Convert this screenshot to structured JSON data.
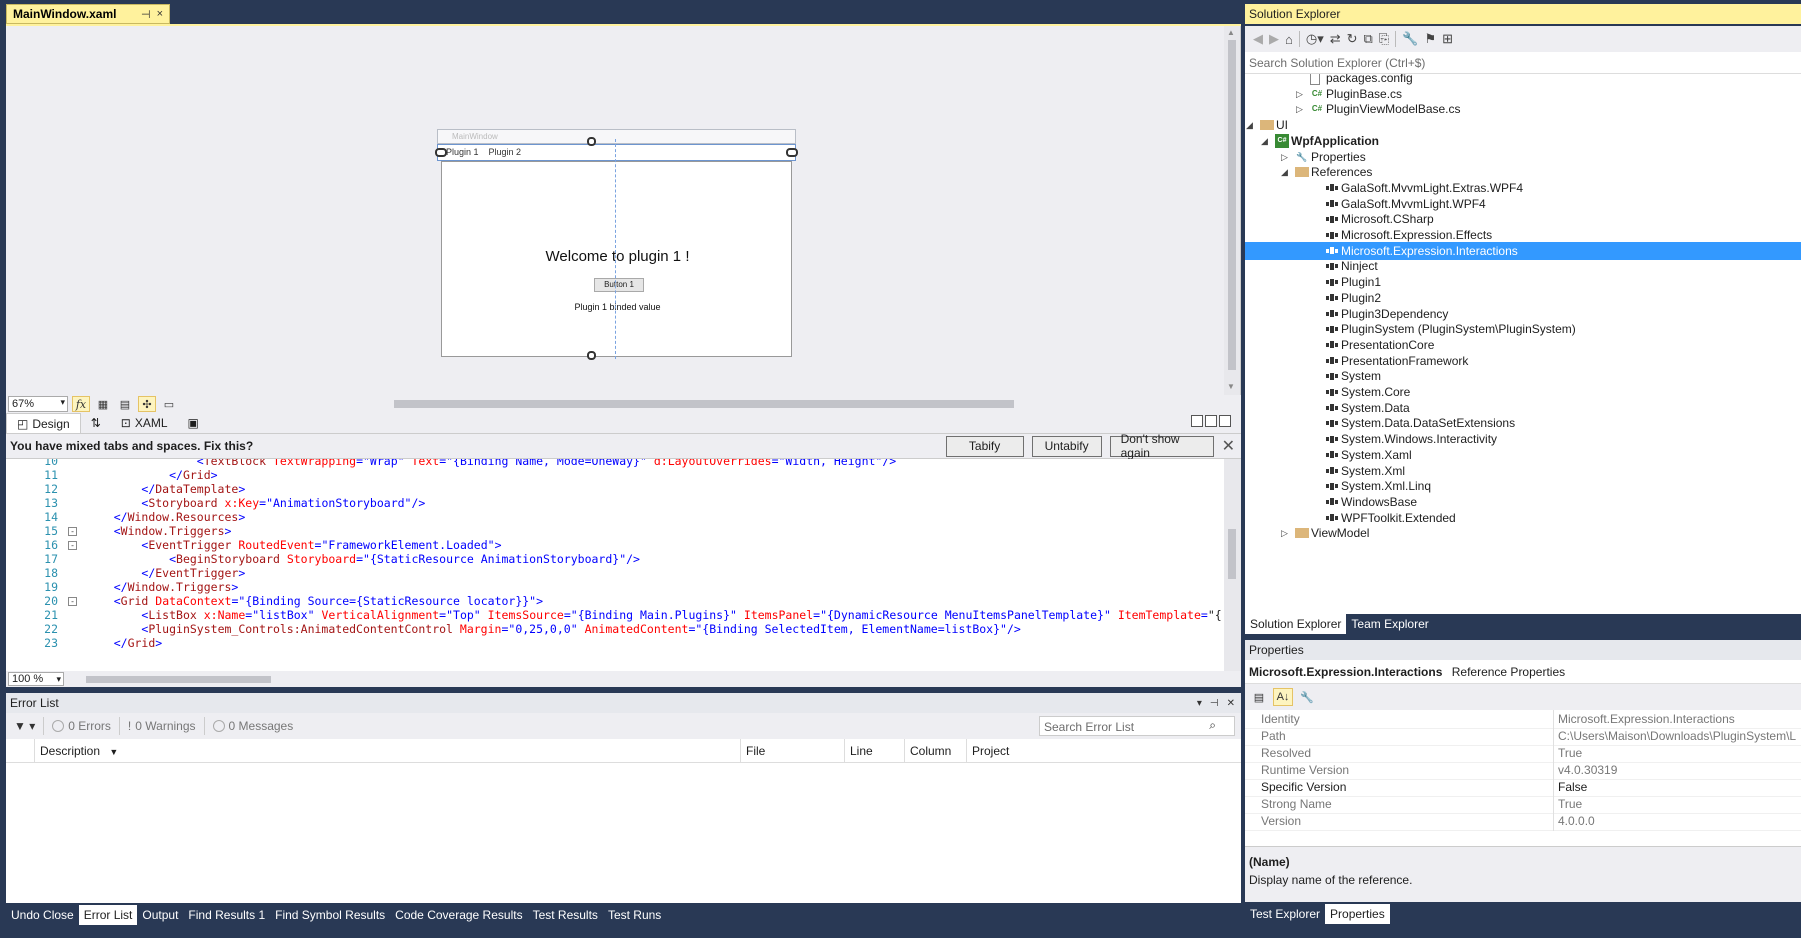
{
  "document_tab": {
    "title": "MainWindow.xaml",
    "pin": "⊣",
    "close": "×"
  },
  "designer": {
    "window_title": "MainWindow",
    "tabs": [
      "Plugin 1",
      "Plugin 2"
    ],
    "welcome": "Welcome to plugin 1 !",
    "button_label": "Button 1",
    "binded_text": "Plugin 1 binded value",
    "zoom": "67%",
    "fx": "fx"
  },
  "view_tabs": {
    "design": "Design",
    "swap": "⇅",
    "xaml": "XAML"
  },
  "infobar": {
    "message": "You have mixed tabs and spaces. Fix this?",
    "tabify": "Tabify",
    "untabify": "Untabify",
    "dont_show": "Don't show again",
    "close": "✕"
  },
  "code_lines": [
    {
      "n": "10",
      "fold": "",
      "text": "                <TextBlock TextWrapping=\"Wrap\" Text=\"{Binding Name, Mode=OneWay}\" d:LayoutOverrides=\"Width, Height\"/>"
    },
    {
      "n": "11",
      "fold": "",
      "text": "            </Grid>"
    },
    {
      "n": "12",
      "fold": "",
      "text": "        </DataTemplate>"
    },
    {
      "n": "13",
      "fold": "",
      "text": "        <Storyboard x:Key=\"AnimationStoryboard\"/>"
    },
    {
      "n": "14",
      "fold": "",
      "text": "    </Window.Resources>"
    },
    {
      "n": "15",
      "fold": "-",
      "text": "    <Window.Triggers>"
    },
    {
      "n": "16",
      "fold": "-",
      "text": "        <EventTrigger RoutedEvent=\"FrameworkElement.Loaded\">"
    },
    {
      "n": "17",
      "fold": "",
      "text": "            <BeginStoryboard Storyboard=\"{StaticResource AnimationStoryboard}\"/>"
    },
    {
      "n": "18",
      "fold": "",
      "text": "        </EventTrigger>"
    },
    {
      "n": "19",
      "fold": "",
      "text": "    </Window.Triggers>"
    },
    {
      "n": "20",
      "fold": "-",
      "text": "    <Grid DataContext=\"{Binding Source={StaticResource locator}}\">"
    },
    {
      "n": "21",
      "fold": "",
      "text": "        <ListBox x:Name=\"listBox\" VerticalAlignment=\"Top\" ItemsSource=\"{Binding Main.Plugins}\" ItemsPanel=\"{DynamicResource MenuItemsPanelTemplate}\" ItemTemplate=\"{"
    },
    {
      "n": "22",
      "fold": "",
      "text": "        <PluginSystem_Controls:AnimatedContentControl Margin=\"0,25,0,0\" AnimatedContent=\"{Binding SelectedItem, ElementName=listBox}\"/>"
    },
    {
      "n": "23",
      "fold": "",
      "text": "    </Grid>"
    }
  ],
  "editor_zoom": "100 %",
  "error_list": {
    "title": "Error List",
    "errors": "0 Errors",
    "warnings": "0 Warnings",
    "messages": "0 Messages",
    "search_placeholder": "Search Error List",
    "columns": [
      "Description",
      "File",
      "Line",
      "Column",
      "Project"
    ]
  },
  "bottom_tabs": [
    "Undo Close",
    "Error List",
    "Output",
    "Find Results 1",
    "Find Symbol Results",
    "Code Coverage Results",
    "Test Results",
    "Test Runs"
  ],
  "solution_explorer": {
    "title": "Solution Explorer",
    "search_placeholder": "Search Solution Explorer (Ctrl+$)",
    "items": [
      {
        "label": "packages.config",
        "type": "config",
        "bold": false
      },
      {
        "label": "PluginBase.cs",
        "type": "cs",
        "bold": false
      },
      {
        "label": "PluginViewModelBase.cs",
        "type": "cs",
        "bold": false
      },
      {
        "label": "UI",
        "type": "folder",
        "bold": false
      },
      {
        "label": "WpfApplication",
        "type": "project",
        "bold": true
      },
      {
        "label": "Properties",
        "type": "wrench",
        "bold": false
      },
      {
        "label": "References",
        "type": "refs",
        "bold": false
      },
      {
        "label": "GalaSoft.MvvmLight.Extras.WPF4",
        "type": "ref",
        "bold": false
      },
      {
        "label": "GalaSoft.MvvmLight.WPF4",
        "type": "ref",
        "bold": false
      },
      {
        "label": "Microsoft.CSharp",
        "type": "ref",
        "bold": false
      },
      {
        "label": "Microsoft.Expression.Effects",
        "type": "ref",
        "bold": false
      },
      {
        "label": "Microsoft.Expression.Interactions",
        "type": "ref",
        "bold": false
      },
      {
        "label": "Ninject",
        "type": "ref",
        "bold": false
      },
      {
        "label": "Plugin1",
        "type": "ref",
        "bold": false
      },
      {
        "label": "Plugin2",
        "type": "ref",
        "bold": false
      },
      {
        "label": "Plugin3Dependency",
        "type": "ref",
        "bold": false
      },
      {
        "label": "PluginSystem (PluginSystem\\PluginSystem)",
        "type": "ref",
        "bold": false
      },
      {
        "label": "PresentationCore",
        "type": "ref",
        "bold": false
      },
      {
        "label": "PresentationFramework",
        "type": "ref",
        "bold": false
      },
      {
        "label": "System",
        "type": "ref",
        "bold": false
      },
      {
        "label": "System.Core",
        "type": "ref",
        "bold": false
      },
      {
        "label": "System.Data",
        "type": "ref",
        "bold": false
      },
      {
        "label": "System.Data.DataSetExtensions",
        "type": "ref",
        "bold": false
      },
      {
        "label": "System.Windows.Interactivity",
        "type": "ref",
        "bold": false
      },
      {
        "label": "System.Xaml",
        "type": "ref",
        "bold": false
      },
      {
        "label": "System.Xml",
        "type": "ref",
        "bold": false
      },
      {
        "label": "System.Xml.Linq",
        "type": "ref",
        "bold": false
      },
      {
        "label": "WindowsBase",
        "type": "ref",
        "bold": false
      },
      {
        "label": "WPFToolkit.Extended",
        "type": "ref",
        "bold": false
      },
      {
        "label": "ViewModel",
        "type": "folder",
        "bold": false
      }
    ],
    "selected_item": "Microsoft.Expression.Interactions",
    "tabs": [
      "Solution Explorer",
      "Team Explorer"
    ]
  },
  "properties": {
    "title": "Properties",
    "object_name": "Microsoft.Expression.Interactions",
    "object_type": "Reference Properties",
    "rows": [
      {
        "name": "Identity",
        "value": "Microsoft.Expression.Interactions",
        "bold": false
      },
      {
        "name": "Path",
        "value": "C:\\Users\\Maison\\Downloads\\PluginSystem\\L",
        "bold": false
      },
      {
        "name": "Resolved",
        "value": "True",
        "bold": false
      },
      {
        "name": "Runtime Version",
        "value": "v4.0.30319",
        "bold": false
      },
      {
        "name": "Specific Version",
        "value": "False",
        "bold": true
      },
      {
        "name": "Strong Name",
        "value": "True",
        "bold": false
      },
      {
        "name": "Version",
        "value": "4.0.0.0",
        "bold": false
      }
    ],
    "desc_title": "(Name)",
    "desc_text": "Display name of the reference.",
    "tabs": [
      "Test Explorer",
      "Properties"
    ]
  },
  "colors": {
    "chrome": "#293955",
    "active_tab": "#fff29d",
    "selection": "#3399ff"
  }
}
